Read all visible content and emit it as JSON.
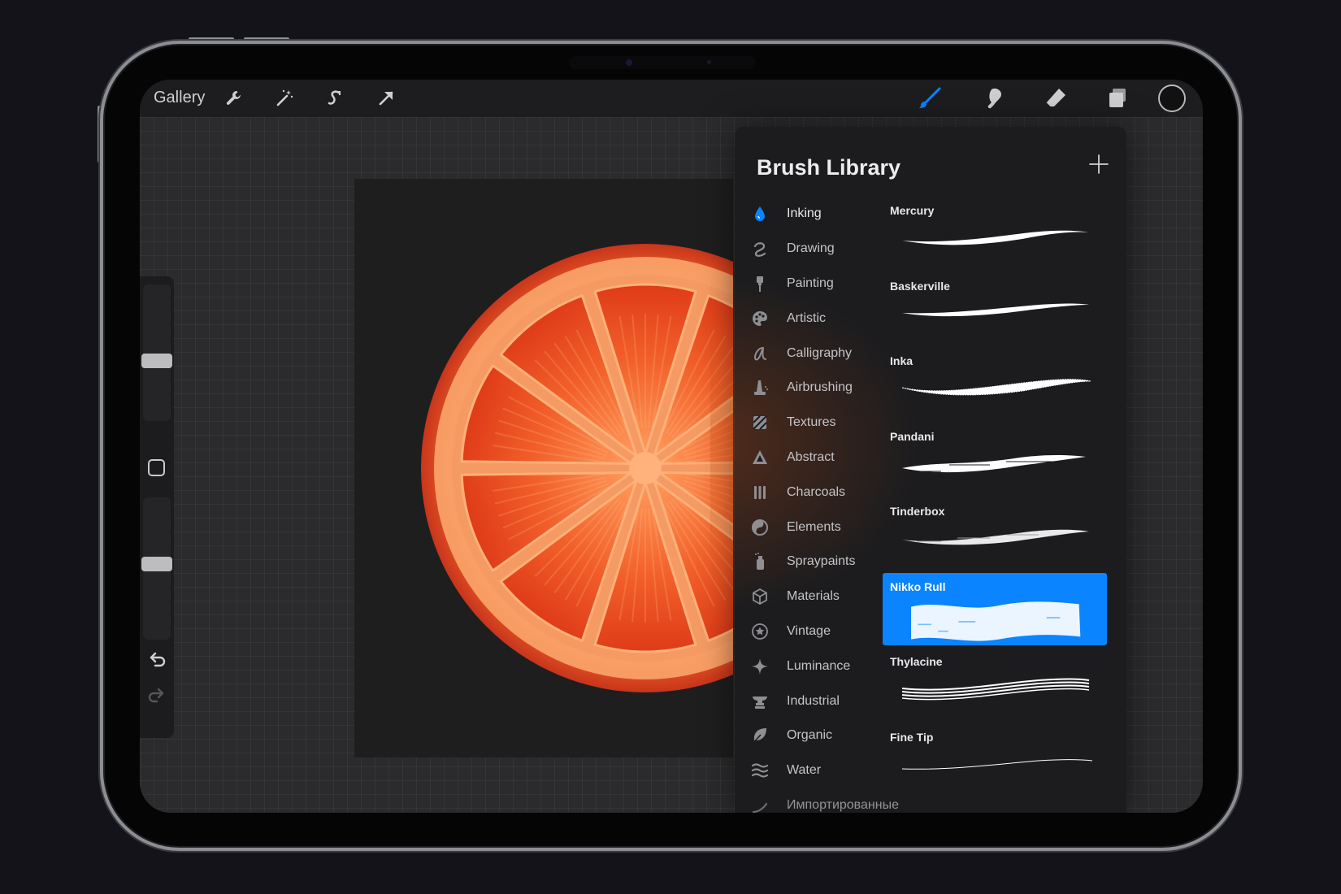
{
  "toolbar": {
    "gallery_label": "Gallery",
    "left_tools": [
      {
        "name": "actions",
        "icon": "wrench-icon"
      },
      {
        "name": "adjustments",
        "icon": "magic-wand-icon"
      },
      {
        "name": "selection",
        "icon": "selection-s-icon"
      },
      {
        "name": "transform",
        "icon": "arrow-cursor-icon"
      }
    ],
    "right_tools": [
      {
        "name": "brush",
        "icon": "brush-icon",
        "active": true
      },
      {
        "name": "smudge",
        "icon": "smudge-icon"
      },
      {
        "name": "eraser",
        "icon": "eraser-icon"
      },
      {
        "name": "layers",
        "icon": "layers-icon"
      }
    ],
    "accent_color": "#0a84ff",
    "current_color": "#111111"
  },
  "sidebar": {
    "brush_size_level": 0.57,
    "opacity_level": 0.6
  },
  "library": {
    "title": "Brush Library",
    "categories": [
      {
        "label": "Inking",
        "icon": "ink-drop-icon",
        "active": true
      },
      {
        "label": "Drawing",
        "icon": "drawing-squiggle-icon"
      },
      {
        "label": "Painting",
        "icon": "paintbrush-icon"
      },
      {
        "label": "Artistic",
        "icon": "palette-icon"
      },
      {
        "label": "Calligraphy",
        "icon": "calligraphy-icon"
      },
      {
        "label": "Airbrushing",
        "icon": "airbrush-icon"
      },
      {
        "label": "Textures",
        "icon": "texture-icon"
      },
      {
        "label": "Abstract",
        "icon": "triangle-icon"
      },
      {
        "label": "Charcoals",
        "icon": "charcoal-icon"
      },
      {
        "label": "Elements",
        "icon": "yin-yang-icon"
      },
      {
        "label": "Spraypaints",
        "icon": "spray-can-icon"
      },
      {
        "label": "Materials",
        "icon": "cube-icon"
      },
      {
        "label": "Vintage",
        "icon": "star-badge-icon"
      },
      {
        "label": "Luminance",
        "icon": "sparkle-icon"
      },
      {
        "label": "Industrial",
        "icon": "anvil-icon"
      },
      {
        "label": "Organic",
        "icon": "leaf-icon"
      },
      {
        "label": "Water",
        "icon": "waves-icon"
      },
      {
        "label": "Импортированные",
        "icon": "import-icon"
      }
    ],
    "brushes": [
      {
        "name": "Mercury"
      },
      {
        "name": "Baskerville"
      },
      {
        "name": "Inka"
      },
      {
        "name": "Pandani"
      },
      {
        "name": "Tinderbox"
      },
      {
        "name": "Nikko Rull",
        "selected": true
      },
      {
        "name": "Thylacine"
      },
      {
        "name": "Fine Tip"
      }
    ]
  }
}
